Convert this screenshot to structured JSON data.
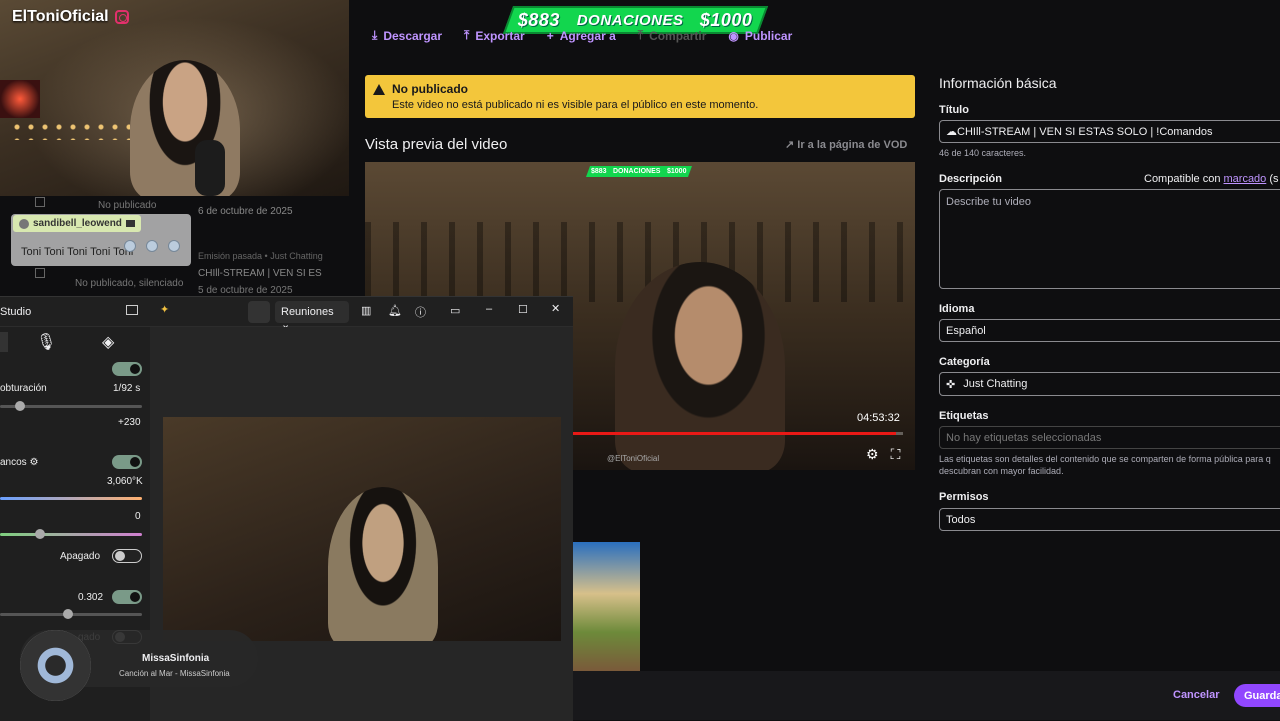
{
  "stream": {
    "streamer": "ElToniOficial",
    "banner": {
      "left": "$883",
      "middle": "DONACIONES",
      "right": "$1000"
    },
    "chat": {
      "user": "sandibell_leowend",
      "message": "Toni Toni Toni Toni Toni"
    }
  },
  "toolbar": {
    "download": "Descargar",
    "export": "Exportar",
    "add_to": "Agregar a",
    "share": "Compartir",
    "publish": "Publicar"
  },
  "bg_list": {
    "status1": "No publicado",
    "date1": "6 de octubre de 2025",
    "meta": "Emisión pasada • Just Chatting",
    "title": "CHIll-STREAM | VEN SI ES",
    "date2": "5 de octubre de 2025",
    "status2": "No publicado, silenciado"
  },
  "notice": {
    "title": "No publicado",
    "text": "Este video no está publicado ni es visible para el público en este momento."
  },
  "preview": {
    "heading": "Vista previa del video",
    "vod_link": "Ir a la página de VOD",
    "timestamp": "04:53:32",
    "progress": 0.98,
    "watermark": "@ElToniOficial"
  },
  "form": {
    "section": "Información básica",
    "title_label": "Título",
    "title_value": "☁CHIll-STREAM | VEN SI ESTAS SOLO | !Comandos",
    "title_count": "46 de 140 caracteres.",
    "desc_label": "Descripción",
    "desc_compat": "Compatible con",
    "desc_link": "marcado",
    "desc_after": "(s",
    "desc_placeholder": "Describe tu video",
    "lang_label": "Idioma",
    "lang_value": "Español",
    "cat_label": "Categoría",
    "cat_value": "Just Chatting",
    "tags_label": "Etiquetas",
    "tags_placeholder": "No hay etiquetas seleccionadas",
    "tags_help1": "Las etiquetas son detalles del contenido que se comparten de forma pública para q",
    "tags_help2": "descubran con mayor facilidad.",
    "perm_label": "Permisos",
    "perm_value": "Todos",
    "cancel": "Cancelar",
    "save": "Guarda"
  },
  "studio": {
    "title": "Studio",
    "dropdown": "Reuniones",
    "shutter_label": "obturación",
    "shutter_value": "1/92 s",
    "gain_value": "+230",
    "wb_label": "ancos",
    "wb_value": "3,060°K",
    "tint_value": "0",
    "off_label": "Apagado",
    "val_302": "0.302",
    "off_label2": "gado",
    "music_artist": "MissaSinfonia",
    "music_track": "Canción al Mar - MissaSinfonia"
  },
  "colors": {
    "accent": "#bf94ff",
    "warning": "#f3c63b",
    "donation": "#12d64e",
    "progress": "#e91916"
  }
}
